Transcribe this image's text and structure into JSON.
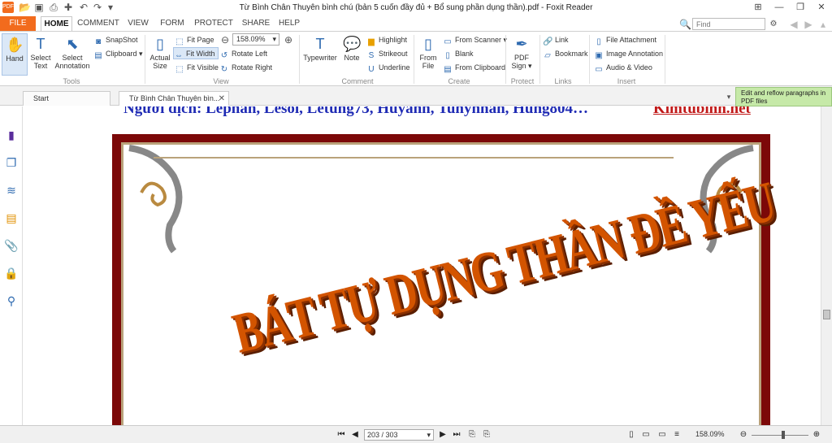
{
  "app": {
    "title": "Từ Bình Chân Thuyên bình chú (bản 5 cuốn đầy đủ + Bổ sung phần dụng thần).pdf - Foxit Reader",
    "logo": "PDF"
  },
  "quick_access": [
    "open-icon",
    "save-icon",
    "print-icon",
    "new-icon",
    "undo-icon",
    "redo-icon",
    "customize-icon"
  ],
  "ribbon_tabs": [
    "FILE",
    "HOME",
    "COMMENT",
    "VIEW",
    "FORM",
    "PROTECT",
    "SHARE",
    "HELP"
  ],
  "search": {
    "placeholder": "Find"
  },
  "ribbon": {
    "tools": {
      "label": "Tools",
      "hand": "Hand",
      "select_text": "Select Text",
      "select_annotation": "Select Annotation",
      "snapshot": "SnapShot",
      "clipboard": "Clipboard"
    },
    "view": {
      "label": "View",
      "actual_size": "Actual Size",
      "fit_page": "Fit Page",
      "fit_width": "Fit Width",
      "fit_visible": "Fit Visible",
      "zoom": "158.09%",
      "rotate_left": "Rotate Left",
      "rotate_right": "Rotate Right"
    },
    "comment": {
      "label": "Comment",
      "typewriter": "Typewriter",
      "note": "Note",
      "highlight": "Highlight",
      "strikeout": "Strikeout",
      "underline": "Underline"
    },
    "create": {
      "label": "Create",
      "from_file": "From File",
      "from_scanner": "From Scanner",
      "blank": "Blank",
      "from_clipboard": "From Clipboard"
    },
    "protect": {
      "label": "Protect",
      "pdf_sign": "PDF Sign"
    },
    "links": {
      "label": "Links",
      "link": "Link",
      "bookmark": "Bookmark"
    },
    "insert": {
      "label": "Insert",
      "file_attachment": "File Attachment",
      "image_annotation": "Image Annotation",
      "audio_video": "Audio & Video"
    }
  },
  "doc_tabs": [
    "Start",
    "Từ Bình Chân Thuyên bìn..."
  ],
  "reflow_tip": "Edit and reflow paragraphs in PDF files",
  "page": {
    "header": "Người dịch: Lephan, Lesoi, Letung73, Huyanh, Tunynhan, Hung804…",
    "link": "Kimtubinh.net",
    "title_art": "BÁT TỰ DỤNG THẦN ĐỀ YẾU"
  },
  "status": {
    "page": "203 / 303",
    "zoom": "158.09%"
  },
  "colors": {
    "accent": "#f26b1d",
    "frame": "#7c0808",
    "title": "#d35400"
  }
}
